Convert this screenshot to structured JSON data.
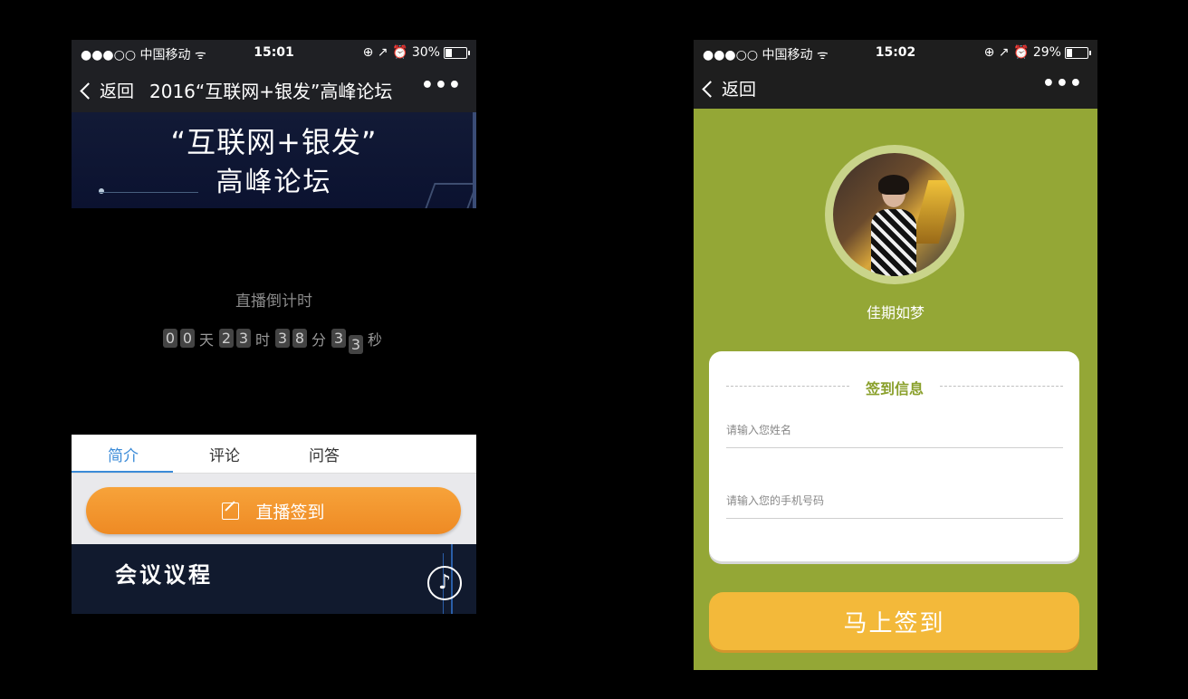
{
  "left_phone": {
    "status": {
      "carrier": "●●●○○ 中国移动 ᯤ",
      "time": "15:01",
      "indicators": "⊕ ↗ ⏰ 30%",
      "battery_pct": 30
    },
    "navbar": {
      "back_label": "返回",
      "title": "2016“互联网+银发”高峰论坛",
      "more_label": "•••"
    },
    "banner": {
      "line1": "“互联网+银发”",
      "line2": "高峰论坛"
    },
    "countdown": {
      "label": "直播倒计时",
      "day_digits": [
        "0",
        "0"
      ],
      "day_unit": "天",
      "hour_digits": [
        "2",
        "3"
      ],
      "hour_unit": "时",
      "min_digits": [
        "3",
        "8"
      ],
      "min_unit": "分",
      "sec_digits": [
        "3",
        "3"
      ],
      "sec_unit": "秒"
    },
    "tabs": [
      "简介",
      "评论",
      "问答"
    ],
    "active_tab": 0,
    "sign_button_label": "直播签到",
    "agenda_title": "会议议程",
    "music_icon": "♪"
  },
  "right_phone": {
    "status": {
      "carrier": "●●●○○ 中国移动 ᯤ",
      "time": "15:02",
      "indicators": "⊕ ↗ ⏰ 29%",
      "battery_pct": 29
    },
    "navbar": {
      "back_label": "返回",
      "more_label": "•••"
    },
    "user_name": "佳期如梦",
    "form": {
      "title": "签到信息",
      "name_placeholder": "请输入您姓名",
      "phone_placeholder": "请输入您的手机号码"
    },
    "submit_label": "马上签到"
  },
  "colors": {
    "accent_blue": "#3b8bd8",
    "orange": "#f29a2e",
    "olive": "#94a736",
    "yellow": "#f3b93a"
  }
}
